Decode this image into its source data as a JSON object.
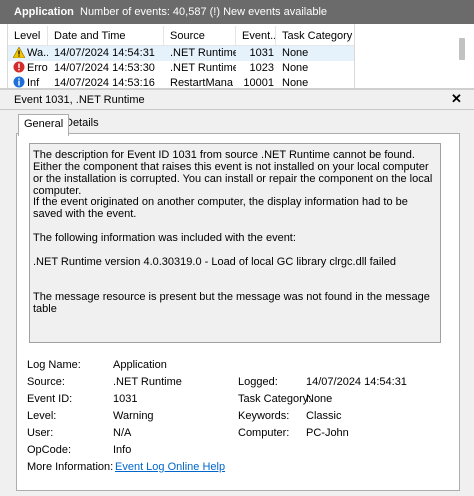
{
  "header": {
    "log_name": "Application",
    "info": "Number of events: 40,587 (!) New events available"
  },
  "grid": {
    "columns": [
      "Level",
      "Date and Time",
      "Source",
      "Event...",
      "Task Category"
    ],
    "rows": [
      {
        "level": "Wa...",
        "level_icon": "warning-icon",
        "date": "14/07/2024 14:54:31",
        "source": ".NET Runtime",
        "event": "1031",
        "category": "None",
        "selected": true
      },
      {
        "level": "Error",
        "level_icon": "error-icon",
        "date": "14/07/2024 14:53:30",
        "source": ".NET Runtime",
        "event": "1023",
        "category": "None",
        "selected": false
      },
      {
        "level": "Inf",
        "level_icon": "info-icon",
        "date": "14/07/2024 14:53:16",
        "source": "RestartMana",
        "event": "10001",
        "category": "None",
        "selected": false
      }
    ]
  },
  "detail": {
    "title": "Event 1031, .NET Runtime",
    "close_glyph": "✕",
    "tabs": [
      "General",
      "Details"
    ],
    "description": [
      "The description for Event ID 1031 from source .NET Runtime cannot be found. Either the component that raises this event is not installed on your local computer or the installation is corrupted. You can install or repair the component on the local computer.",
      "If the event originated on another computer, the display information had to be saved with the event.",
      "The following information was included with the event:",
      ".NET Runtime version 4.0.30319.0 - Load of local GC library clrgc.dll failed",
      "The message resource is present but the message was not found in the message table"
    ],
    "props": {
      "log_name_label": "Log Name:",
      "log_name": "Application",
      "source_label": "Source:",
      "source": ".NET Runtime",
      "logged_label": "Logged:",
      "logged": "14/07/2024 14:54:31",
      "event_id_label": "Event ID:",
      "event_id": "1031",
      "task_category_label": "Task Category:",
      "task_category": "None",
      "level_label": "Level:",
      "level": "Warning",
      "keywords_label": "Keywords:",
      "keywords": "Classic",
      "user_label": "User:",
      "user": "N/A",
      "computer_label": "Computer:",
      "computer": "PC-John",
      "opcode_label": "OpCode:",
      "opcode": "Info",
      "more_info_label": "More Information:",
      "more_info_link": "Event Log Online Help"
    }
  },
  "colors": {
    "accent_link": "#0066cc",
    "selected_row": "#e5f1fb",
    "titlebar": "#6b6b6b"
  }
}
